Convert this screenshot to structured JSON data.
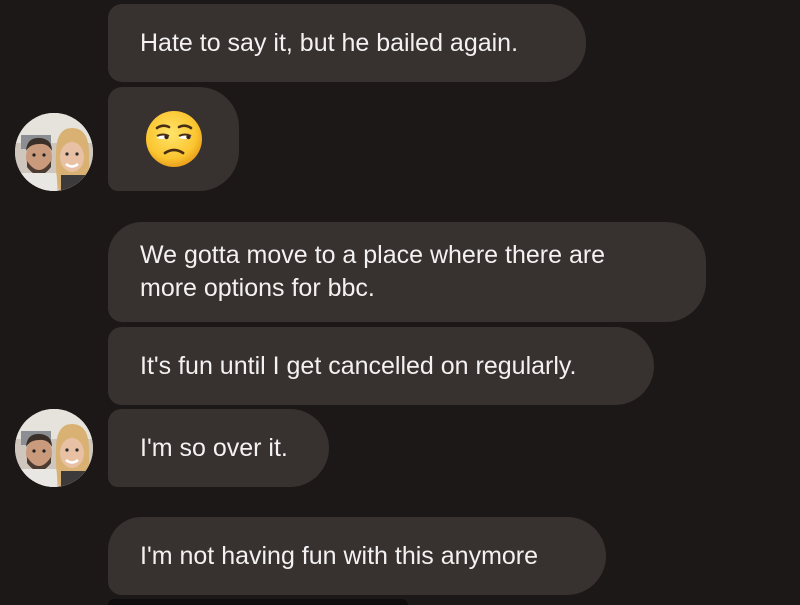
{
  "conversation": {
    "messages": [
      {
        "text": "Hate to say it, but he bailed again."
      },
      {
        "emoji": "unamused-face-emoji"
      },
      {
        "lines": [
          "We gotta move to a place where there are",
          "more options for bbc."
        ]
      },
      {
        "text": "It's fun until I get cancelled on regularly."
      },
      {
        "text": "I'm so over it."
      },
      {
        "text": "I'm not having fun with this anymore"
      }
    ]
  },
  "colors": {
    "background": "#1d1818",
    "bubble": "#373130",
    "text": "#f3f1f1"
  }
}
